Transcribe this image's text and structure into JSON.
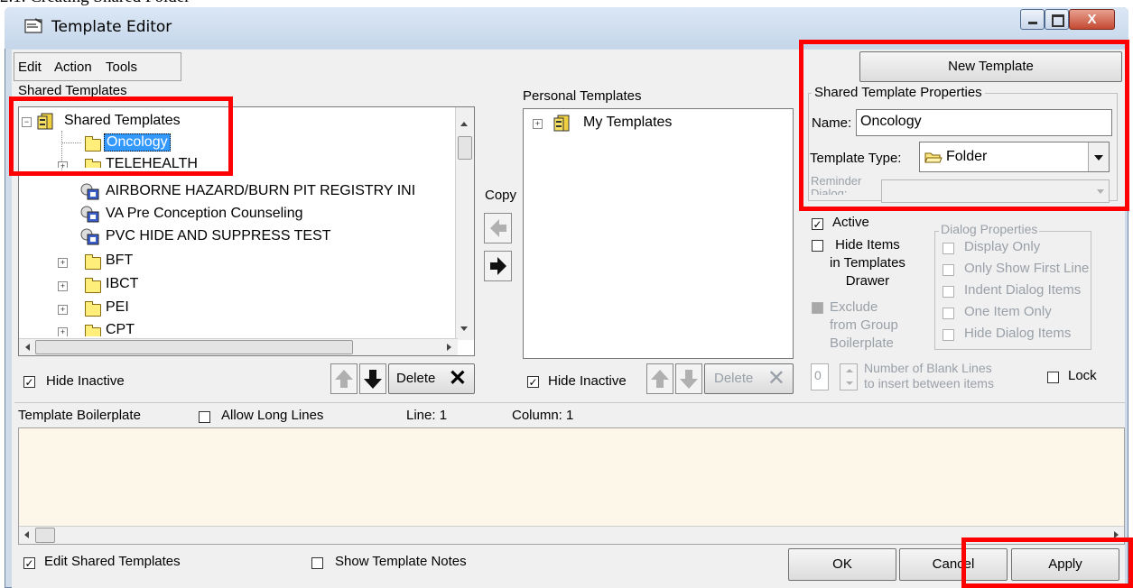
{
  "doc": {
    "heading": "2.1. Creating Shared Folder"
  },
  "window": {
    "title": "Template Editor",
    "close_glyph": "X"
  },
  "menu": {
    "edit": "Edit",
    "action": "Action",
    "tools": "Tools"
  },
  "shared": {
    "label": "Shared Templates",
    "root": "Shared Templates",
    "items": [
      {
        "label": "Oncology",
        "type": "folder",
        "selected": true
      },
      {
        "label": "TELEHEALTH",
        "type": "folder"
      },
      {
        "label": "AIRBORNE HAZARD/BURN PIT REGISTRY INI",
        "type": "template"
      },
      {
        "label": "VA Pre Conception Counseling",
        "type": "template"
      },
      {
        "label": "PVC HIDE AND SUPPRESS TEST",
        "type": "template"
      },
      {
        "label": "BFT",
        "type": "folder"
      },
      {
        "label": "IBCT",
        "type": "folder"
      },
      {
        "label": "PEI",
        "type": "folder"
      },
      {
        "label": "CPT",
        "type": "folder"
      }
    ],
    "hide_inactive": "Hide Inactive",
    "delete": "Delete"
  },
  "copy": {
    "label": "Copy"
  },
  "personal": {
    "label": "Personal Templates",
    "root": "My Templates",
    "hide_inactive": "Hide Inactive",
    "delete": "Delete"
  },
  "properties": {
    "new_template": "New Template",
    "group_title": "Shared Template Properties",
    "name_label": "Name:",
    "name_value": "Oncology",
    "type_label": "Template Type:",
    "type_value": "Folder",
    "reminder_label_1": "Reminder",
    "reminder_label_2": "Dialog:",
    "active": "Active",
    "hide_items_1": "Hide Items",
    "hide_items_2": "in Templates",
    "hide_items_3": "Drawer",
    "exclude_1": "Exclude",
    "exclude_2": "from Group",
    "exclude_3": "Boilerplate",
    "dialog_group": "Dialog Properties",
    "dialog_opts": [
      "Display Only",
      "Only Show First Line",
      "Indent Dialog Items",
      "One Item Only",
      "Hide Dialog Items"
    ],
    "blank_value": "0",
    "blank_label_1": "Number of Blank Lines",
    "blank_label_2": "to insert between items",
    "lock": "Lock"
  },
  "boilerplate": {
    "label": "Template Boilerplate",
    "allow_long": "Allow Long Lines",
    "line": "Line: 1",
    "column": "Column: 1"
  },
  "footer": {
    "edit_shared": "Edit Shared Templates",
    "show_notes": "Show Template Notes",
    "ok": "OK",
    "cancel": "Cancel",
    "apply": "Apply"
  },
  "colors": {
    "highlight": "#ff0000",
    "selection": "#3399ff",
    "boilerplate_bg": "#fdf7ea"
  }
}
